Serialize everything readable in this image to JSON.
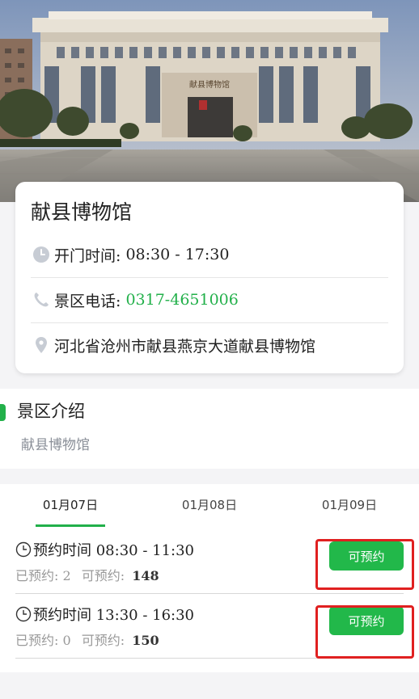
{
  "museum": {
    "name": "献县博物馆",
    "hours_label": "开门时间: ",
    "hours_value": "08:30 - 17:30",
    "phone_label": "景区电话: ",
    "phone_value": "0317-4651006",
    "address": "河北省沧州市献县燕京大道献县博物馆",
    "building_sign": "献县博物馆"
  },
  "intro": {
    "title": "景区介绍",
    "text": "献县博物馆"
  },
  "booking": {
    "dates": [
      "01月07日",
      "01月08日",
      "01月09日"
    ],
    "selected_date_index": 0,
    "slots": [
      {
        "time": "预约时间 08:30 - 11:30",
        "booked_label": "已预约:",
        "booked": "2",
        "available_label": "可预约:",
        "available": "148",
        "button": "可预约"
      },
      {
        "time": "预约时间 13:30 - 16:30",
        "booked_label": "已预约:",
        "booked": "0",
        "available_label": "可预约:",
        "available": "150",
        "button": "可预约"
      }
    ]
  },
  "colors": {
    "accent": "#22b04a",
    "highlight": "#e02020"
  },
  "icons": [
    "clock-icon",
    "phone-icon",
    "location-pin-icon"
  ]
}
